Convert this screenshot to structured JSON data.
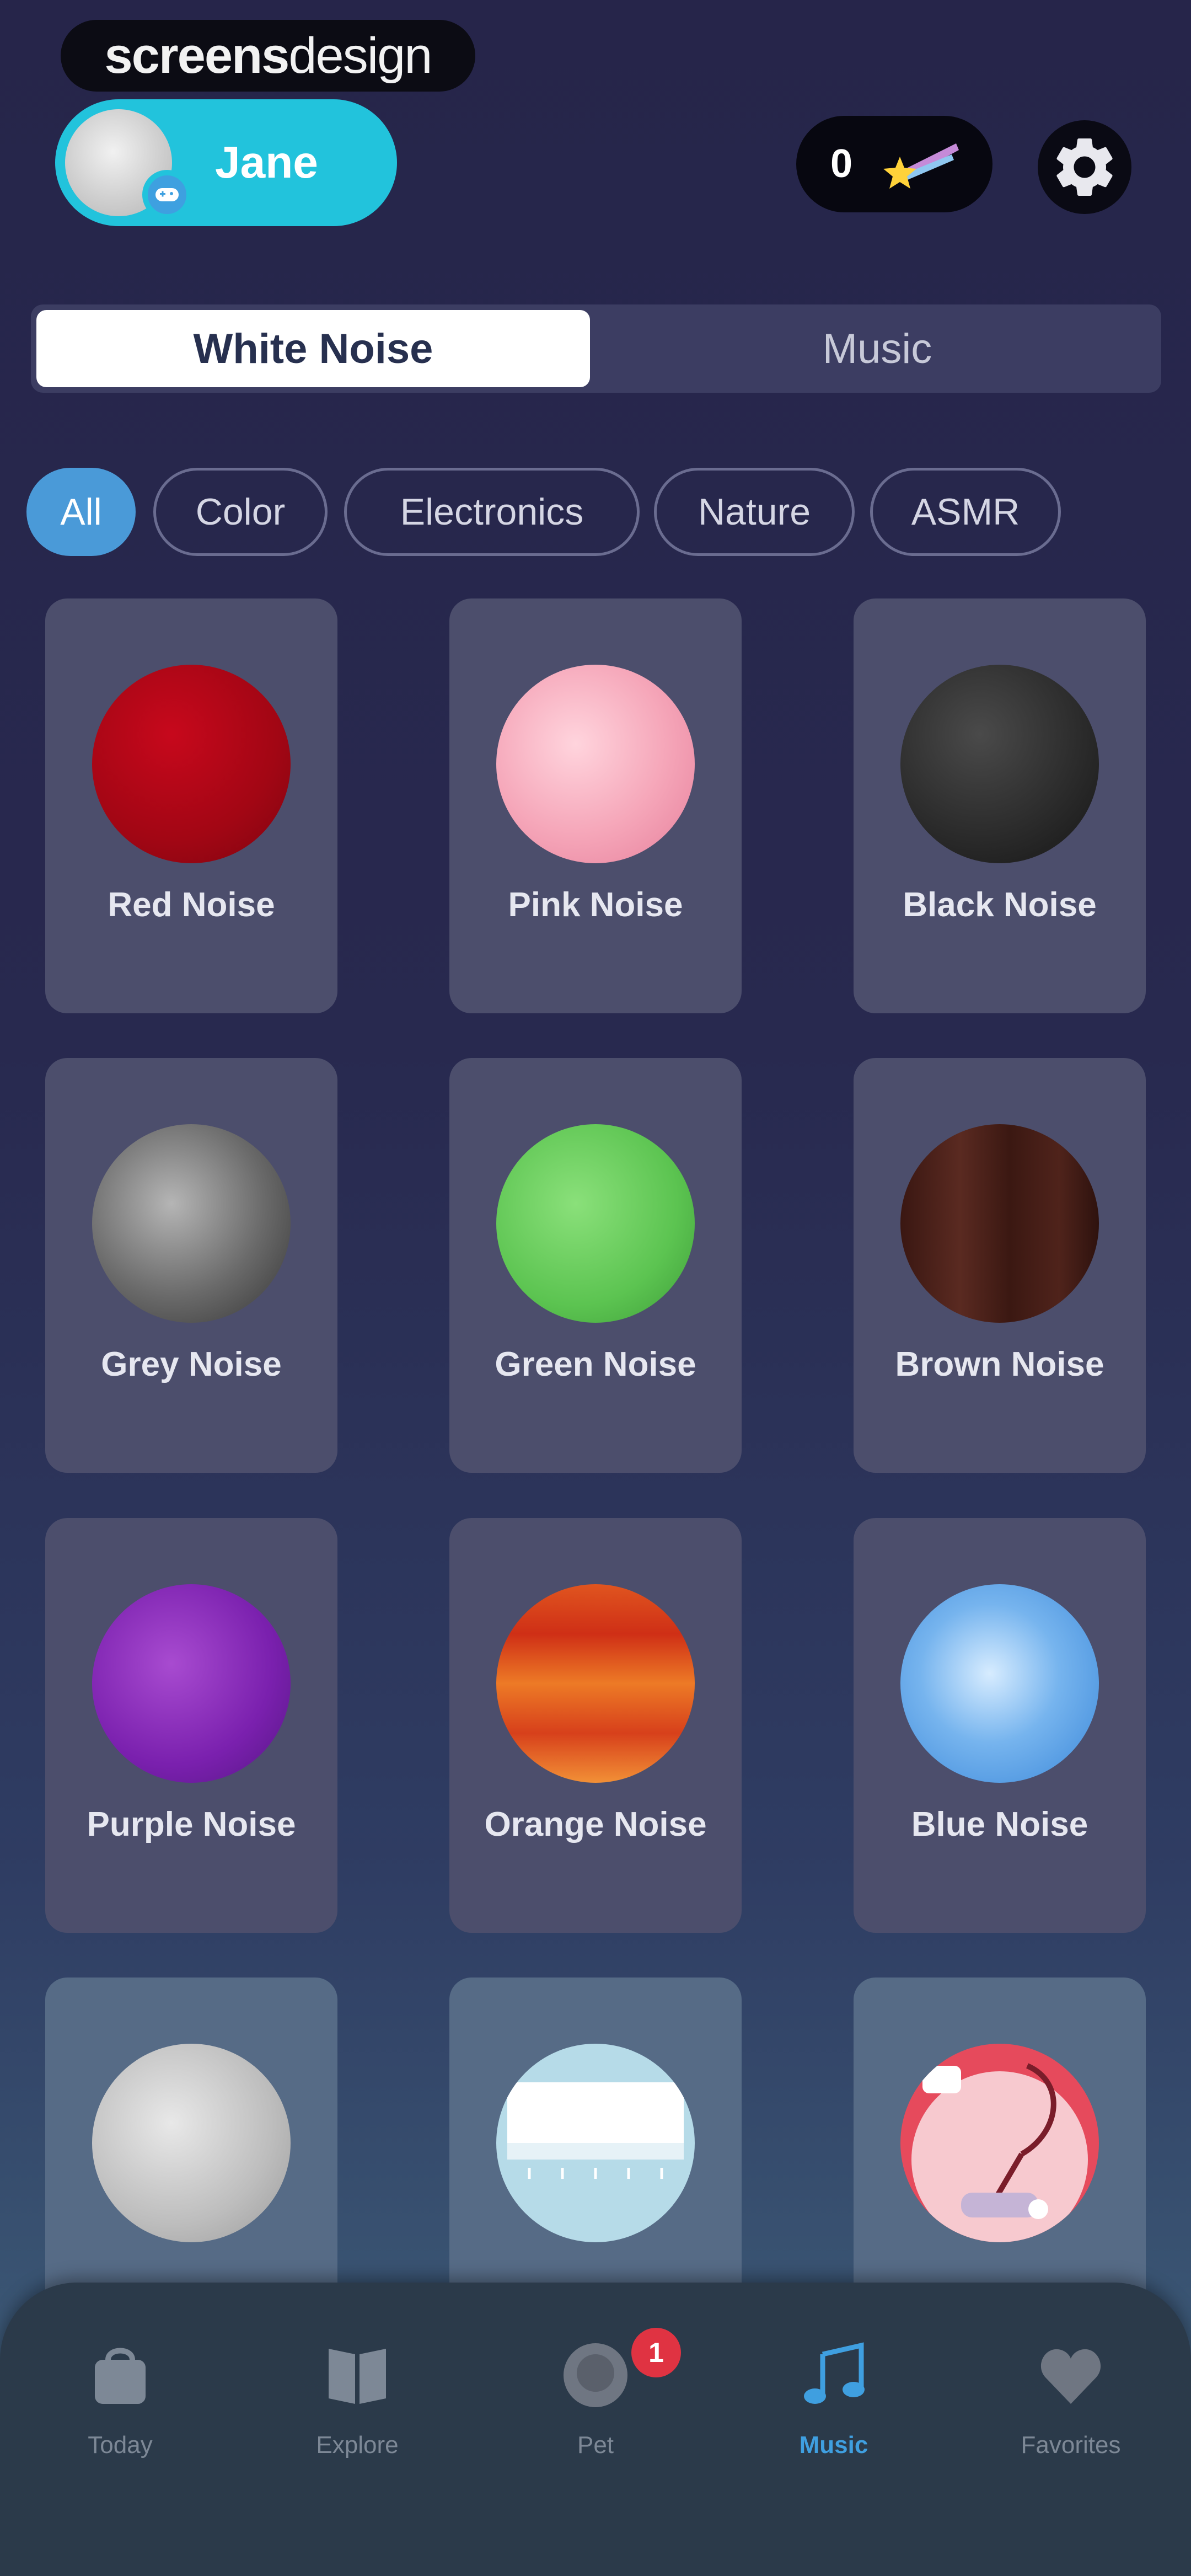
{
  "watermark": {
    "bold": "screens",
    "light": "design"
  },
  "header": {
    "profile_name": "Jane",
    "coin_count": "0"
  },
  "segments": [
    {
      "label": "White Noise",
      "active": true
    },
    {
      "label": "Music",
      "active": false
    }
  ],
  "filters": [
    {
      "label": "All",
      "active": true
    },
    {
      "label": "Color",
      "active": false
    },
    {
      "label": "Electronics",
      "active": false
    },
    {
      "label": "Nature",
      "active": false
    },
    {
      "label": "ASMR",
      "active": false
    }
  ],
  "sounds": [
    {
      "label": "Red Noise"
    },
    {
      "label": "Pink Noise"
    },
    {
      "label": "Black Noise"
    },
    {
      "label": "Grey Noise"
    },
    {
      "label": "Green Noise"
    },
    {
      "label": "Brown Noise"
    },
    {
      "label": "Purple Noise"
    },
    {
      "label": "Orange Noise"
    },
    {
      "label": "Blue Noise"
    },
    {
      "label": ""
    },
    {
      "label": ""
    },
    {
      "label": ""
    }
  ],
  "bottom_nav": [
    {
      "label": "Today",
      "icon": "bag-icon",
      "active": false
    },
    {
      "label": "Explore",
      "icon": "book-icon",
      "active": false
    },
    {
      "label": "Pet",
      "icon": "pet-icon",
      "active": false,
      "badge": "1"
    },
    {
      "label": "Music",
      "icon": "music-note-icon",
      "active": true
    },
    {
      "label": "Favorites",
      "icon": "heart-icon",
      "active": false
    }
  ],
  "colors": {
    "accent": "#22c3dc",
    "active_chip": "#4a9ad8",
    "active_tab": "#3f9fe0",
    "badge": "#e03342"
  }
}
